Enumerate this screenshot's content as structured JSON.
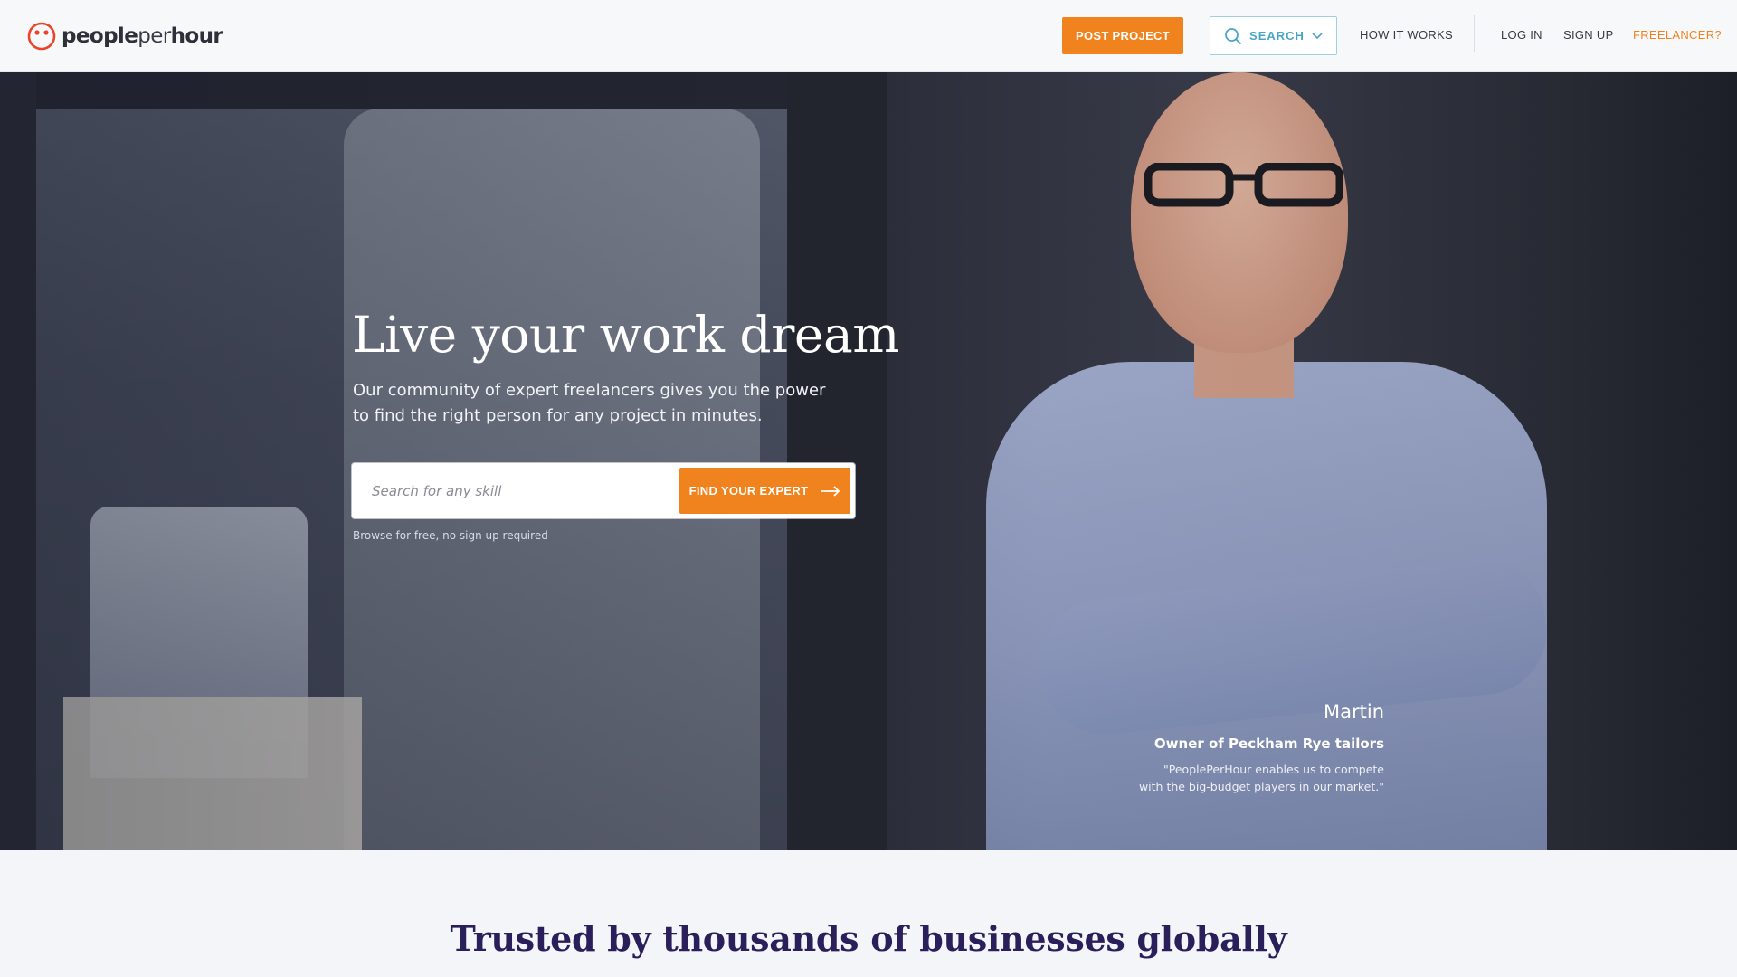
{
  "header": {
    "logo": {
      "bold": "people",
      "light": "per",
      "bold2": "hour"
    },
    "post_project_label": "POST PROJECT",
    "search_label": "SEARCH",
    "how_it_works_label": "HOW IT WORKS",
    "login_label": "LOG IN",
    "signup_label": "SIGN UP",
    "freelancer_label": "FREELANCER?"
  },
  "hero": {
    "title": "Live your work dream",
    "subtitle_line1": "Our community of expert freelancers gives you the power",
    "subtitle_line2": "to find the right person for any project in minutes.",
    "search_placeholder": "Search for any skill",
    "find_button_label": "FIND YOUR EXPERT",
    "browse_note": "Browse for free, no sign up required",
    "testimonial": {
      "name": "Martin",
      "role": "Owner of Peckham Rye tailors",
      "quote_line1": "\"PeoplePerHour enables us to compete",
      "quote_line2": "with the big-budget players in our market.\""
    }
  },
  "trusted_heading": "Trusted by thousands of businesses globally",
  "colors": {
    "accent_orange": "#f1831e",
    "search_blue": "#48a5c9",
    "heading_purple": "#2a1f5a"
  },
  "icons": [
    "logo-face-icon",
    "search-icon",
    "chevron-down-icon",
    "arrow-right-icon"
  ]
}
